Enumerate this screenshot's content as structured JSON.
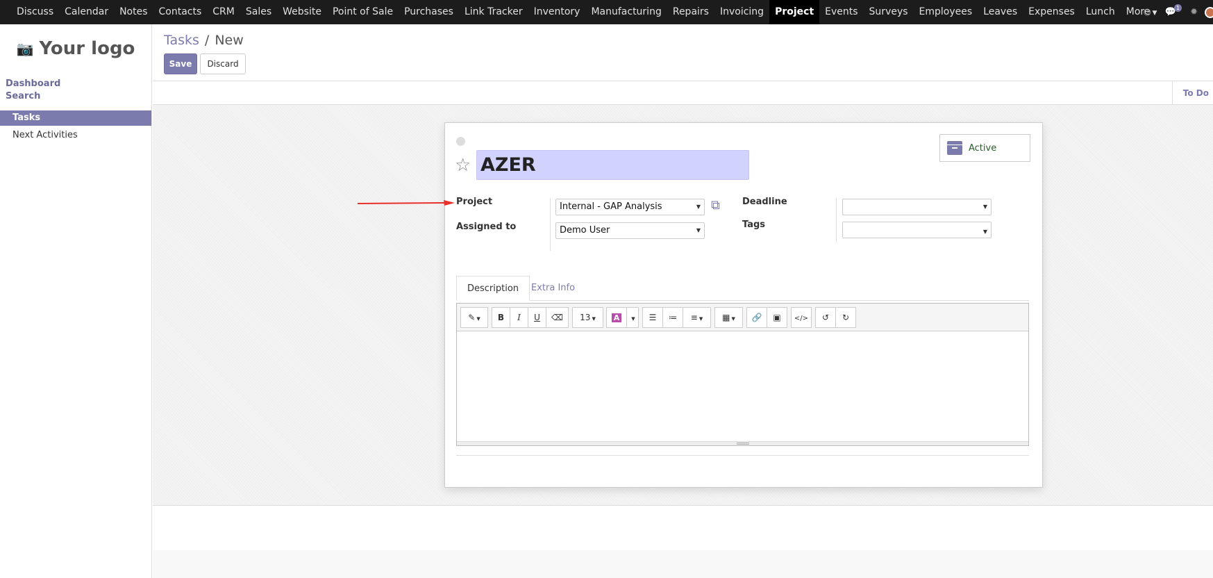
{
  "nav": {
    "items": [
      "Discuss",
      "Calendar",
      "Notes",
      "Contacts",
      "CRM",
      "Sales",
      "Website",
      "Point of Sale",
      "Purchases",
      "Link Tracker",
      "Inventory",
      "Manufacturing",
      "Repairs",
      "Invoicing",
      "Project",
      "Events",
      "Surveys",
      "Employees",
      "Leaves",
      "Expenses",
      "Lunch",
      "More"
    ],
    "active": "Project",
    "messages_count": "1"
  },
  "sidebar": {
    "logo_text": "Your logo",
    "sections": [
      "Dashboard",
      "Search"
    ],
    "items": [
      "Tasks",
      "Next Activities"
    ]
  },
  "control": {
    "breadcrumb_parent": "Tasks",
    "breadcrumb_sep": "/",
    "breadcrumb_current": "New",
    "save_label": "Save",
    "discard_label": "Discard"
  },
  "status": {
    "stage": "To Do"
  },
  "form": {
    "title": "AZER",
    "active_label": "Active",
    "project_label": "Project",
    "project_value": "Internal - GAP Analysis",
    "assigned_label": "Assigned to",
    "assigned_value": "Demo User",
    "deadline_label": "Deadline",
    "deadline_value": "",
    "tags_label": "Tags",
    "tags_value": ""
  },
  "tabs": [
    "Description",
    "Extra Info"
  ],
  "editor": {
    "font_size": "13"
  },
  "colors": {
    "brand": "#7c7bad",
    "title_bg": "#d2d2ff",
    "annotation_arrow": "#e8302a"
  }
}
